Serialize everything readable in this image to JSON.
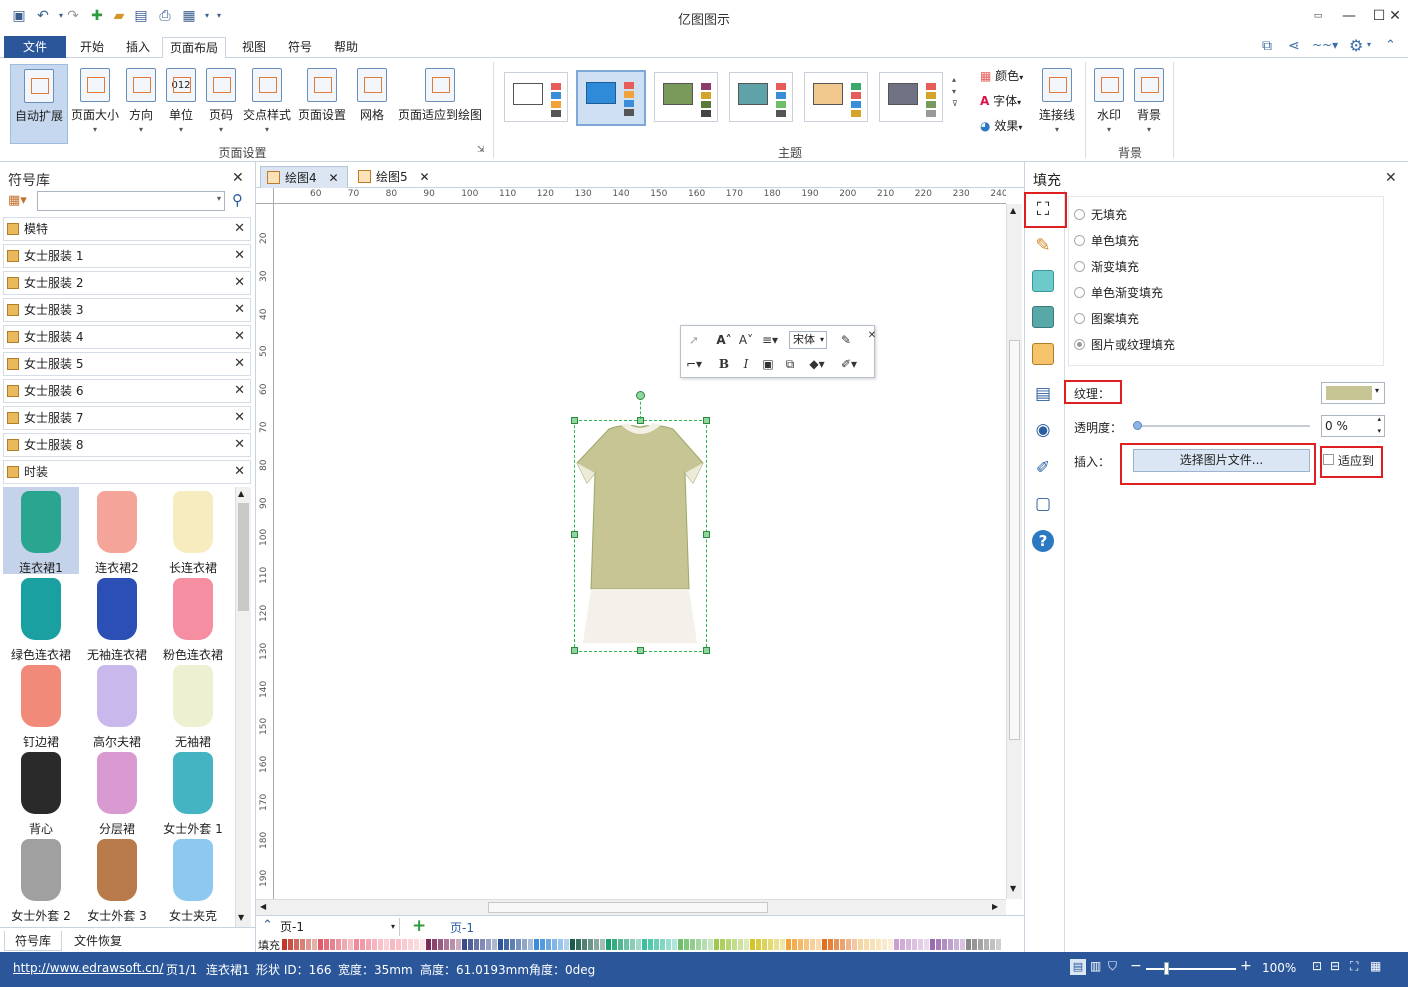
{
  "app": {
    "title": "亿图图示"
  },
  "menu": {
    "file": "文件",
    "items": [
      "开始",
      "插入",
      "页面布局",
      "视图",
      "符号",
      "帮助"
    ]
  },
  "ribbon": {
    "page_setup_buttons": [
      "自动扩展",
      "页面大小",
      "方向",
      "单位",
      "页码",
      "交点样式",
      "页面设置",
      "网格",
      "页面适应到绘图"
    ],
    "page_setup_label": "页面设置",
    "theme_label": "主题",
    "theme_side": [
      "颜色",
      "字体",
      "效果"
    ],
    "connector": "连接线",
    "background_buttons": [
      "水印",
      "背景"
    ],
    "background_label": "背景",
    "unit_icon_text": "012",
    "font_icon_text": "A",
    "theme_colors": [
      "#e55c58",
      "#3c8dd8",
      "#7a9a5c",
      "#5fa3a8",
      "#f1c88d",
      "#6f7283"
    ]
  },
  "library": {
    "title": "符号库",
    "categories": [
      "模特",
      "女士服装 1",
      "女士服装 2",
      "女士服装 3",
      "女士服装 4",
      "女士服装 5",
      "女士服装 6",
      "女士服装 7",
      "女士服装 8",
      "时装"
    ],
    "shapes": [
      {
        "label": "连衣裙1",
        "color": "#2aa590"
      },
      {
        "label": "连衣裙2",
        "color": "#f5a49a"
      },
      {
        "label": "长连衣裙",
        "color": "#f6ecc0"
      },
      {
        "label": "绿色连衣裙",
        "color": "#1aa0a0"
      },
      {
        "label": "无袖连衣裙",
        "color": "#2b4fb5"
      },
      {
        "label": "粉色连衣裙",
        "color": "#f58ea0"
      },
      {
        "label": "钉边裙",
        "color": "#f28a7a"
      },
      {
        "label": "高尔夫裙",
        "color": "#c9b8ec"
      },
      {
        "label": "无袖裙",
        "color": "#eef0d2"
      },
      {
        "label": "背心",
        "color": "#2a2a2a"
      },
      {
        "label": "分层裙",
        "color": "#d99ad1"
      },
      {
        "label": "女士外套 1",
        "color": "#44b3c2"
      },
      {
        "label": "女士外套 2",
        "color": "#a0a0a0"
      },
      {
        "label": "女士外套 3",
        "color": "#b87a4a"
      },
      {
        "label": "女士夹克",
        "color": "#8cc8f0"
      }
    ],
    "tabs": [
      "符号库",
      "文件恢复"
    ]
  },
  "documents": {
    "tabs": [
      "绘图4",
      "绘图5"
    ]
  },
  "ruler": {
    "top": [
      "60",
      "70",
      "80",
      "90",
      "100",
      "110",
      "120",
      "130",
      "140",
      "150",
      "160",
      "170",
      "180",
      "190",
      "200",
      "210",
      "220",
      "230",
      "240"
    ],
    "left": [
      "20",
      "30",
      "40",
      "50",
      "60",
      "70",
      "80",
      "90",
      "100",
      "110",
      "120",
      "130",
      "140",
      "150",
      "160",
      "170",
      "180",
      "190"
    ]
  },
  "float_toolbar": {
    "font": "宋体"
  },
  "pages": {
    "page_name": "页-1",
    "active_tab": "页-1",
    "fill_label": "填充"
  },
  "fill_panel": {
    "title": "填充",
    "options": [
      "无填充",
      "单色填充",
      "渐变填充",
      "单色渐变填充",
      "图案填充",
      "图片或纹理填充"
    ],
    "selected": "图片或纹理填充",
    "texture_label": "纹理：",
    "transparency_label": "透明度：",
    "transparency_value": "0 %",
    "insert_label": "插入：",
    "choose_file_button": "选择图片文件...",
    "fit_label": "适应到"
  },
  "status": {
    "url": "http://www.edrawsoft.cn/",
    "page": "页1/1",
    "shape_name": "连衣裙1",
    "shape_id": "形状 ID：166",
    "width": "宽度：35mm",
    "height": "高度：61.0193mm",
    "angle": "角度：0deg",
    "zoom": "100%"
  }
}
